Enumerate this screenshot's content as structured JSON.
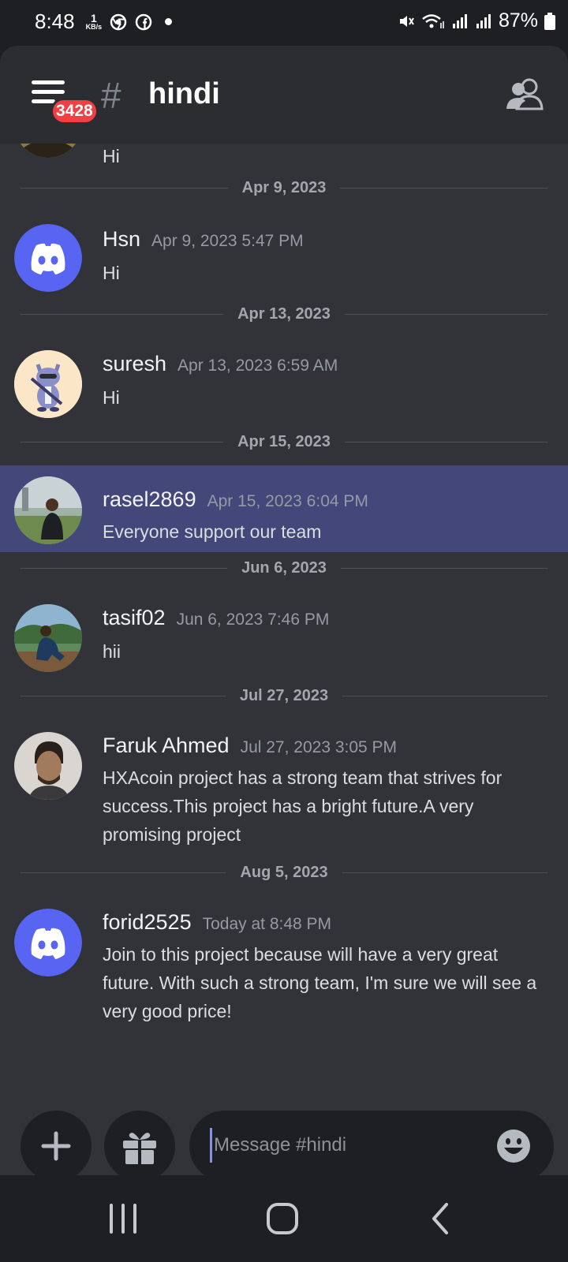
{
  "status_bar": {
    "time": "8:48",
    "net_speed": "1",
    "net_unit": "KB/s",
    "battery": "87%"
  },
  "header": {
    "notification_count": "3428",
    "channel_name": "hindi"
  },
  "partial_message": {
    "text": "Hi"
  },
  "messages": [
    {
      "date_divider": "Apr 9, 2023",
      "author": "Hsn",
      "timestamp": "Apr 9, 2023 5:47 PM",
      "text": "Hi"
    },
    {
      "date_divider": "Apr 13, 2023",
      "author": "suresh",
      "timestamp": "Apr 13, 2023 6:59 AM",
      "text": "Hi"
    },
    {
      "date_divider": "Apr 15, 2023",
      "author": "rasel2869",
      "timestamp": "Apr 15, 2023 6:04 PM",
      "text": "Everyone support our team"
    },
    {
      "date_divider": "Jun 6, 2023",
      "author": "tasif02",
      "timestamp": "Jun 6, 2023 7:46 PM",
      "text": "hii"
    },
    {
      "date_divider": "Jul 27, 2023",
      "author": "Faruk Ahmed",
      "timestamp": "Jul 27, 2023 3:05 PM",
      "text": "HXAcoin project has a strong team that strives for success.This project has a bright future.A very promising project"
    },
    {
      "date_divider": "Aug 5, 2023",
      "author": "forid2525",
      "timestamp": "Today at 8:48 PM",
      "text": "Join to this project because will have a very great future. With such a strong team, I'm sure we will see a very good price!"
    }
  ],
  "composer": {
    "placeholder": "Message #hindi"
  },
  "colors": {
    "accent": "#5865f2",
    "highlight": "#434779",
    "badge": "#f23f43",
    "background": "#313338"
  }
}
